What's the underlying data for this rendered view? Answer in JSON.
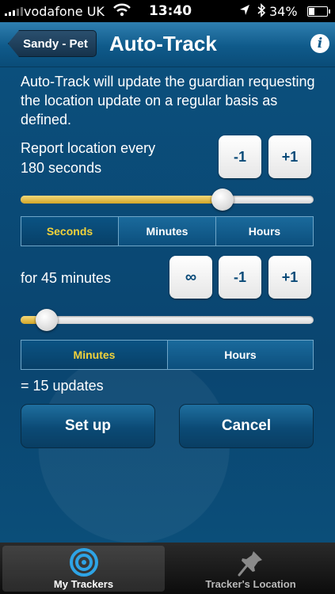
{
  "status": {
    "carrier": "vodafone UK",
    "time": "13:40",
    "battery": "34%",
    "battery_level": 0.34
  },
  "nav": {
    "back_label": "Sandy - Pet",
    "title": "Auto-Track",
    "info_glyph": "i"
  },
  "intro": "Auto-Track will update the guardian requesting the location update on a regular basis as defined.",
  "report": {
    "line1": "Report location every",
    "line2": "180 seconds",
    "minus_label": "-1",
    "plus_label": "+1",
    "slider_level": 0.69,
    "units": [
      "Seconds",
      "Minutes",
      "Hours"
    ],
    "selected_unit": "Seconds"
  },
  "duration": {
    "label": "for 45 minutes",
    "infinite_label": "∞",
    "minus_label": "-1",
    "plus_label": "+1",
    "slider_level": 0.09,
    "units": [
      "Minutes",
      "Hours"
    ],
    "selected_unit": "Minutes"
  },
  "summary": "= 15 updates",
  "actions": {
    "setup_label": "Set up",
    "cancel_label": "Cancel"
  },
  "tabs": [
    {
      "label": "My Trackers",
      "icon": "target-icon",
      "active": true
    },
    {
      "label": "Tracker's Location",
      "icon": "pushpin-icon",
      "active": false
    }
  ],
  "colors": {
    "accent_selected_text": "#f2d23a",
    "slider_fill": "#d2a629",
    "background": "#0b4a73"
  }
}
